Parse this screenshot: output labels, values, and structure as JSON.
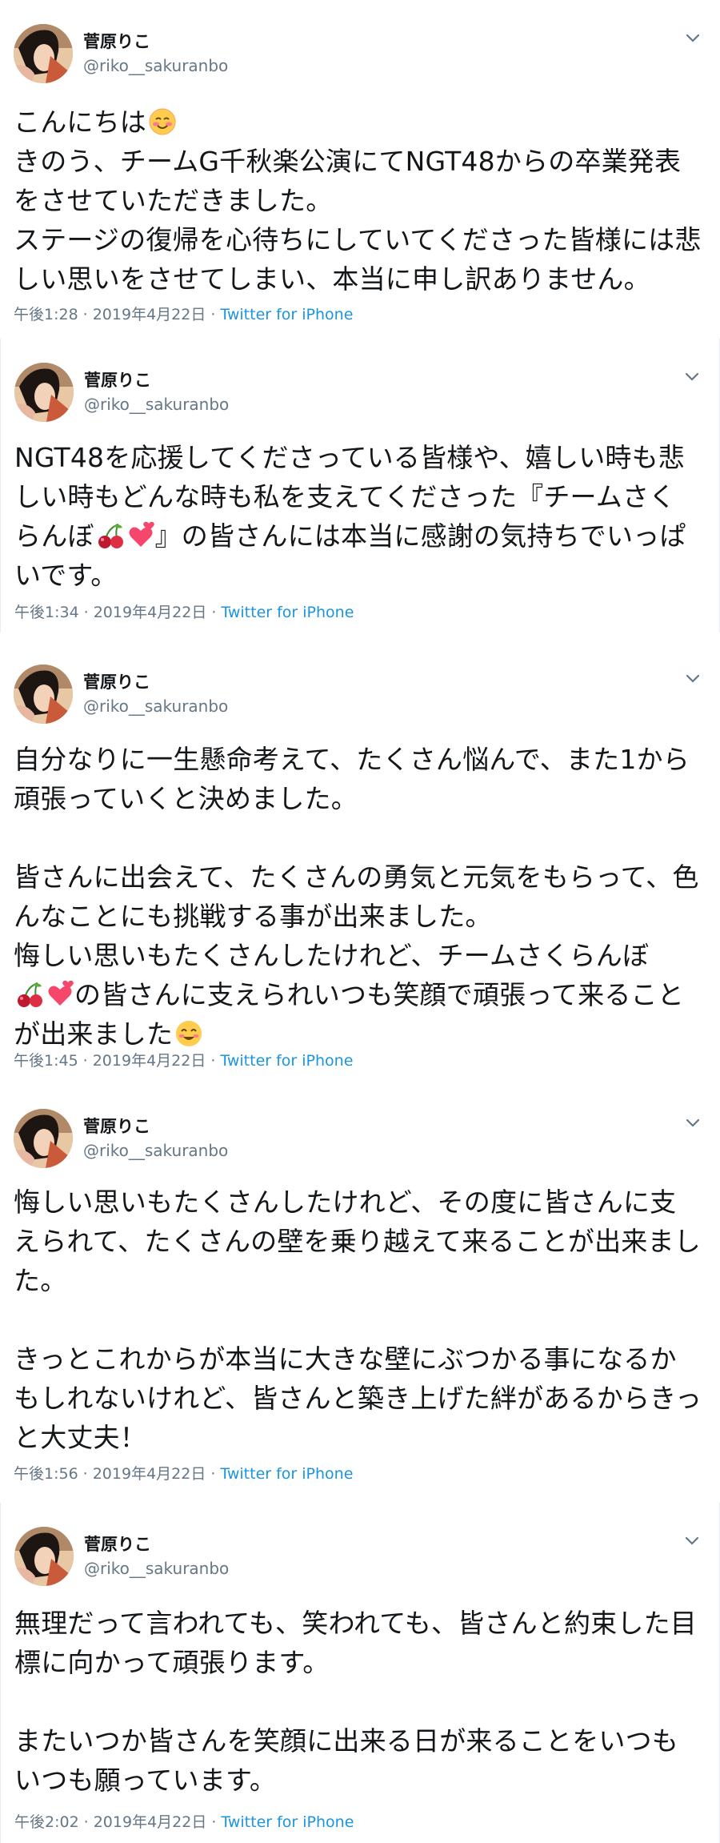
{
  "author": {
    "name": "菅原りこ",
    "handle": "@riko__sakuranbo"
  },
  "icons": {
    "menu": "chevron-down-icon",
    "emoji_blush": "blush-emoji-icon",
    "emoji_cherries": "cherries-emoji-icon",
    "emoji_two_hearts": "two-hearts-emoji-icon",
    "emoji_smile": "smiling-face-emoji-icon"
  },
  "colors": {
    "link": "#1b95e0",
    "muted": "#657786",
    "text": "#14171a"
  },
  "tweets": [
    {
      "text_a": "こんにちは",
      "text_b": "\nきのう、チームG千秋楽公演にてNGT48からの卒業発表をさせていただきました。\nステージの復帰を心待ちにしていてくださった皆様には悲しい思いをさせてしまい、本当に申し訳ありません。",
      "time": "午後1:28",
      "date": "2019年4月22日",
      "source": "Twitter for iPhone"
    },
    {
      "text_a": "NGT48を応援してくださっている皆様や、嬉しい時も悲しい時もどんな時も私を支えてくださった『チームさくらんぼ",
      "text_b": "』の皆さんには本当に感謝の気持ちでいっぱいです。",
      "time": "午後1:34",
      "date": "2019年4月22日",
      "source": "Twitter for iPhone"
    },
    {
      "text_a": "自分なりに一生懸命考えて、たくさん悩んで、また1から頑張っていくと決めました。\n\n皆さんに出会えて、たくさんの勇気と元気をもらって、色んなことにも挑戦する事が出来ました。\n悔しい思いもたくさんしたけれど、チームさくらんぼ\n",
      "text_b": "の皆さんに支えられいつも笑顔で頑張って来ることが出来ました",
      "time": "午後1:45",
      "date": "2019年4月22日",
      "source": "Twitter for iPhone"
    },
    {
      "text_a": "悔しい思いもたくさんしたけれど、その度に皆さんに支えられて、たくさんの壁を乗り越えて来ることが出来ました。\n\nきっとこれからが本当に大きな壁にぶつかる事になるかもしれないけれど、皆さんと築き上げた絆があるからきっと大丈夫！",
      "time": "午後1:56",
      "date": "2019年4月22日",
      "source": "Twitter for iPhone"
    },
    {
      "text_a": "無理だって言われても、笑われても、皆さんと約束した目標に向かって頑張ります。\n\nまたいつか皆さんを笑顔に出来る日が来ることをいつもいつも願っています。",
      "time": "午後2:02",
      "date": "2019年4月22日",
      "source": "Twitter for iPhone"
    }
  ]
}
